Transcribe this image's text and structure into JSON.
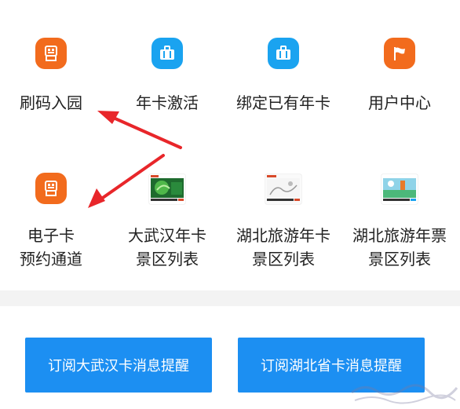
{
  "row1": [
    {
      "label": "刷码入园",
      "icon": "qr-hand-icon",
      "color": "#f26b1d"
    },
    {
      "label": "年卡激活",
      "icon": "briefcase-icon",
      "color": "#1aa3f0"
    },
    {
      "label": "绑定已有年卡",
      "icon": "briefcase-icon",
      "color": "#1aa3f0"
    },
    {
      "label": "用户中心",
      "icon": "flag-icon",
      "color": "#f26b1d"
    }
  ],
  "row2": [
    {
      "line1": "电子卡",
      "line2": "预约通道",
      "icon": "qr-hand-icon",
      "color": "#f26b1d"
    },
    {
      "line1": "大武汉年卡",
      "line2": "景区列表",
      "thumb": "card-thumb-green"
    },
    {
      "line1": "湖北旅游年卡",
      "line2": "景区列表",
      "thumb": "card-thumb-white"
    },
    {
      "line1": "湖北旅游年票",
      "line2": "景区列表",
      "thumb": "card-thumb-landscape"
    }
  ],
  "buttons": {
    "wuhan": "订阅大武汉卡消息提醒",
    "hubei": "订阅湖北省卡消息提醒"
  },
  "annotation": {
    "arrow_color": "#e8262a"
  }
}
